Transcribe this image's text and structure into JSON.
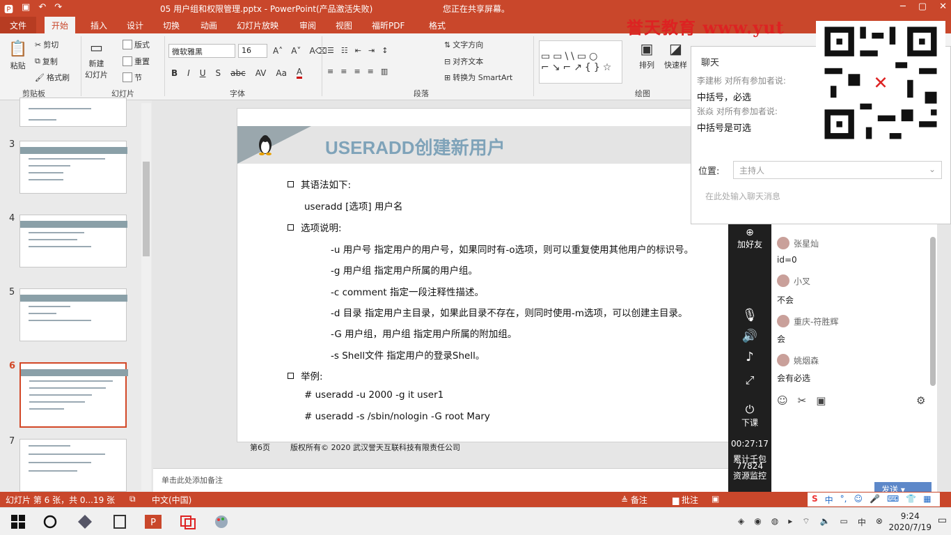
{
  "titlebar": {
    "doc_title": "05 用户组和权限管理.pptx",
    "app_title": "PowerPoint(产品激活失败)",
    "share_notice": "您正在共享屏幕。"
  },
  "brand": "誉天教育  www.yut",
  "tabs": [
    "文件",
    "开始",
    "插入",
    "设计",
    "切换",
    "动画",
    "幻灯片放映",
    "审阅",
    "视图",
    "福昕PDF",
    "格式"
  ],
  "ribbon": {
    "clipboard": {
      "paste": "粘贴",
      "cut": "剪切",
      "copy": "复制",
      "painter": "格式刷",
      "label": "剪贴板"
    },
    "slides": {
      "new_slide": "新建\n幻灯片",
      "layout": "版式",
      "reset": "重置",
      "section": "节",
      "label": "幻灯片"
    },
    "font": {
      "name": "微软雅黑",
      "size": "16",
      "label": "字体"
    },
    "paragraph": {
      "text_dir": "文字方向",
      "align_text": "对齐文本",
      "smartart": "转换为 SmartArt",
      "label": "段落"
    },
    "drawing": {
      "arrange": "排列",
      "quick_styles": "快速样",
      "label": "绘图"
    }
  },
  "thumbs": [
    {
      "num": "3"
    },
    {
      "num": "4"
    },
    {
      "num": "5"
    },
    {
      "num": "6"
    },
    {
      "num": "7"
    }
  ],
  "slide": {
    "title": "USERADD创建新用户",
    "lines": [
      "其语法如下:",
      "useradd  [选项]  用户名",
      "选项说明:",
      "-u 用户号 指定用户的用户号，如果同时有-o选项，则可以重复使用其他用户的标识号。",
      "-g 用户组 指定用户所属的用户组。",
      "-c comment 指定一段注释性描述。",
      "-d 目录 指定用户主目录，如果此目录不存在，则同时使用-m选项，可以创建主目录。",
      "-G 用户组，用户组 指定用户所属的附加组。",
      "-s Shell文件 指定用户的登录Shell。",
      "举例:",
      "# useradd -u 2000 -g it  user1",
      "# useradd -s /sbin/nologin  -G root  Mary"
    ],
    "page": "第6页",
    "copyright": "版权所有© 2020 武汉誉天互联科技有限责任公司"
  },
  "notes_placeholder": "单击此处添加备注",
  "statusbar": {
    "slide_info": "幻灯片 第 6 张，共 0...19 张",
    "lang": "中文(中国)",
    "notes": "备注",
    "comments": "批注"
  },
  "chat": {
    "title": "聊天",
    "messages": [
      {
        "from": "李建彬 对所有参加者说:",
        "text": "中括号，必选"
      },
      {
        "from": "张焱 对所有参加者说:",
        "text": "中括号是可选"
      }
    ],
    "position_label": "位置:",
    "position_value": "主持人",
    "input_placeholder": "在此处输入聊天消息"
  },
  "livebar": {
    "add_friend": "加好友",
    "end_class": "下课",
    "timer": "00:27:17",
    "gift_label": "累计壬包",
    "gift_count": "77824",
    "monitor": "资源监控"
  },
  "comments": [
    {
      "user": "张星灿",
      "text": "id=0"
    },
    {
      "user": "小叉",
      "text": "不会"
    },
    {
      "user": "重庆-符胜辉",
      "text": "会"
    },
    {
      "user": "姚烟森",
      "text": "会有必选"
    }
  ],
  "send_label": "发送",
  "clock": {
    "time": "9:24",
    "date": "2020/7/19"
  },
  "ime": "中",
  "colors": {
    "accent": "#c9472b",
    "title_blue": "#7fa3b9"
  }
}
